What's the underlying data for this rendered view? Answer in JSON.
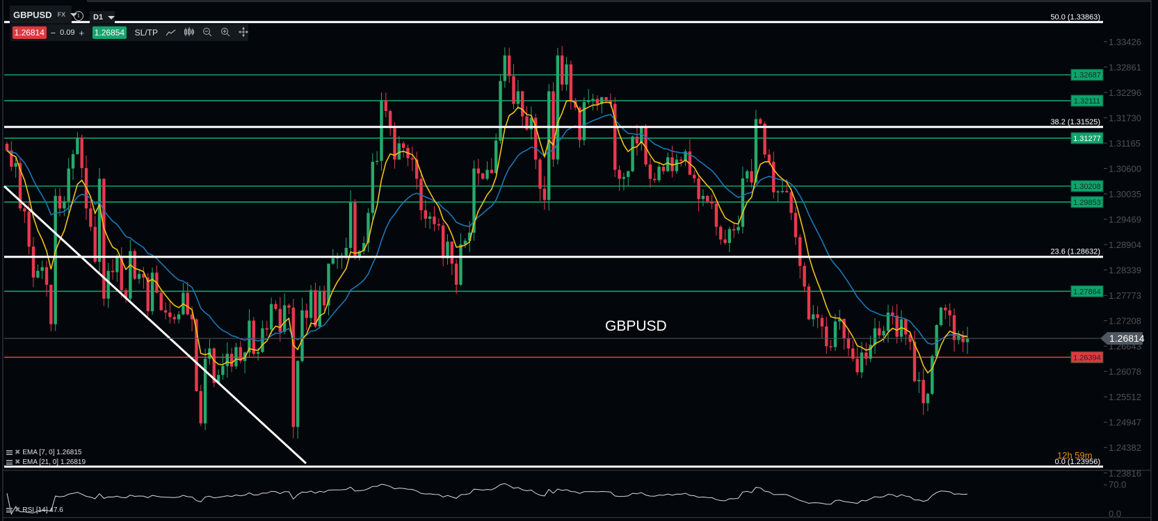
{
  "header": {
    "symbol": "GBPUSD",
    "market": "FX",
    "timeframe": "D1",
    "info_icon": "info-icon"
  },
  "trade": {
    "sell_price": "1.26814",
    "minus": "−",
    "quantity": "0.09",
    "plus": "+",
    "buy_price": "1.26854",
    "sltp": "SL/TP"
  },
  "toolbar_icons": [
    "line-chart-icon",
    "candles-icon",
    "zoom-out-icon",
    "zoom-in-icon",
    "move-icon"
  ],
  "watermark": "GBPUSD",
  "countdown": "12h 59m",
  "colors": {
    "background": "#03070b",
    "bull": "#26a96c",
    "bear": "#e8384f",
    "level_green": "#0fa36b",
    "level_red": "#e0393e",
    "ema7": "#f2c318",
    "ema21": "#1a78b8",
    "fib": "#ffffff",
    "current_price": "#4f5860"
  },
  "chart_data": {
    "type": "candlestick",
    "symbol": "GBPUSD",
    "timeframe": "D1",
    "closes": [
      1.31,
      1.3064,
      1.3072,
      1.2971,
      1.2964,
      1.2886,
      1.2817,
      1.2832,
      1.284,
      1.2801,
      1.2713,
      1.2999,
      1.2971,
      1.2987,
      1.306,
      1.3092,
      1.3129,
      1.3061,
      1.2971,
      1.293,
      1.2852,
      1.3037,
      1.277,
      1.2832,
      1.2829,
      1.2863,
      1.2789,
      1.277,
      1.2876,
      1.2814,
      1.2825,
      1.2817,
      1.2742,
      1.2828,
      1.2783,
      1.2744,
      1.2739,
      1.2729,
      1.2724,
      1.2735,
      1.2783,
      1.2735,
      1.2724,
      1.2564,
      1.2492,
      1.2636,
      1.2659,
      1.2582,
      1.26,
      1.262,
      1.2647,
      1.2619,
      1.2662,
      1.2631,
      1.265,
      1.2721,
      1.2647,
      1.2651,
      1.2704,
      1.2701,
      1.2758,
      1.2747,
      1.2696,
      1.2755,
      1.275,
      1.2484,
      1.2631,
      1.2744,
      1.2727,
      1.2789,
      1.2708,
      1.2786,
      1.2755,
      1.2848,
      1.286,
      1.2863,
      1.2866,
      1.2883,
      1.2984,
      1.2863,
      1.2876,
      1.2894,
      1.2961,
      1.3075,
      1.3077,
      1.3212,
      1.3188,
      1.315,
      1.308,
      1.3116,
      1.3106,
      1.3083,
      1.308,
      1.3037,
      1.2967,
      1.2948,
      1.2953,
      1.2936,
      1.2933,
      1.286,
      1.2897,
      1.2848,
      1.2801,
      1.2891,
      1.2899,
      1.2917,
      1.306,
      1.3049,
      1.3037,
      1.3057,
      1.305,
      1.3122,
      1.3255,
      1.3312,
      1.3266,
      1.3204,
      1.3232,
      1.3176,
      1.3147,
      1.3173,
      1.308,
      1.3015,
      1.299,
      1.3232,
      1.308,
      1.3312,
      1.3247,
      1.3292,
      1.3212,
      1.3196,
      1.3123,
      1.3208,
      1.3212,
      1.3215,
      1.3204,
      1.3219,
      1.3212,
      1.3204,
      1.3057,
      1.3037,
      1.3041,
      1.3054,
      1.3131,
      1.3116,
      1.3153,
      1.3069,
      1.3037,
      1.3034,
      1.3064,
      1.3054,
      1.3085,
      1.3054,
      1.308,
      1.3077,
      1.3098,
      1.3046,
      1.3038,
      1.2992,
      1.2999,
      1.2987,
      1.2982,
      1.293,
      1.2902,
      1.2894,
      1.2925,
      1.2922,
      1.293,
      1.3038,
      1.3054,
      1.3029,
      1.317,
      1.316,
      1.3091,
      1.3075,
      1.3007,
      1.3009,
      1.301,
      1.3007,
      1.2961,
      1.2907,
      1.2843,
      1.2797,
      1.2724,
      1.2735,
      1.2727,
      1.2708,
      1.2664,
      1.2662,
      1.2719,
      1.2725,
      1.2681,
      1.2659,
      1.2636,
      1.2606,
      1.265,
      1.2636,
      1.2667,
      1.2704,
      1.2688,
      1.2698,
      1.2739,
      1.2732,
      1.2685,
      1.2724,
      1.269,
      1.2674,
      1.2586,
      1.2589,
      1.2537,
      1.2558,
      1.2642,
      1.2711,
      1.275,
      1.2744,
      1.2733,
      1.2678,
      1.2687,
      1.2673,
      1.2681
    ],
    "price_axis_ticks": [
      "1.33426",
      "1.32861",
      "1.32296",
      "1.31730",
      "1.31165",
      "1.30600",
      "1.30035",
      "1.29469",
      "1.28904",
      "1.28339",
      "1.27773",
      "1.27208",
      "1.26643",
      "1.26078",
      "1.25512",
      "1.24947",
      "1.24382",
      "1.23816"
    ],
    "current_price": "1.26814",
    "levels": [
      {
        "price": "1.32687",
        "kind": "resistance"
      },
      {
        "price": "1.32111",
        "kind": "resistance"
      },
      {
        "price": "1.31277",
        "kind": "resistance"
      },
      {
        "price": "1.30208",
        "kind": "resistance"
      },
      {
        "price": "1.29853",
        "kind": "resistance"
      },
      {
        "price": "1.27864",
        "kind": "resistance"
      },
      {
        "price": "1.26394",
        "kind": "support"
      }
    ],
    "fibonacci": [
      {
        "label": "50.0 (1.33863)",
        "price": 1.33863
      },
      {
        "label": "38.2 (1.31525)",
        "price": 1.31525
      },
      {
        "label": "23.6 (1.28632)",
        "price": 1.28632
      },
      {
        "label": "0.0 (1.23956)",
        "price": 1.23956
      }
    ],
    "indicators": {
      "ema7": {
        "label": "EMA [7, 0] 1.26815",
        "period": 7
      },
      "ema21": {
        "label": "EMA [21, 0] 1.26819",
        "period": 21
      },
      "rsi": {
        "label": "RSI [14] 47.6",
        "period": 14,
        "ticks": [
          "70.0",
          "0.0"
        ]
      }
    }
  }
}
